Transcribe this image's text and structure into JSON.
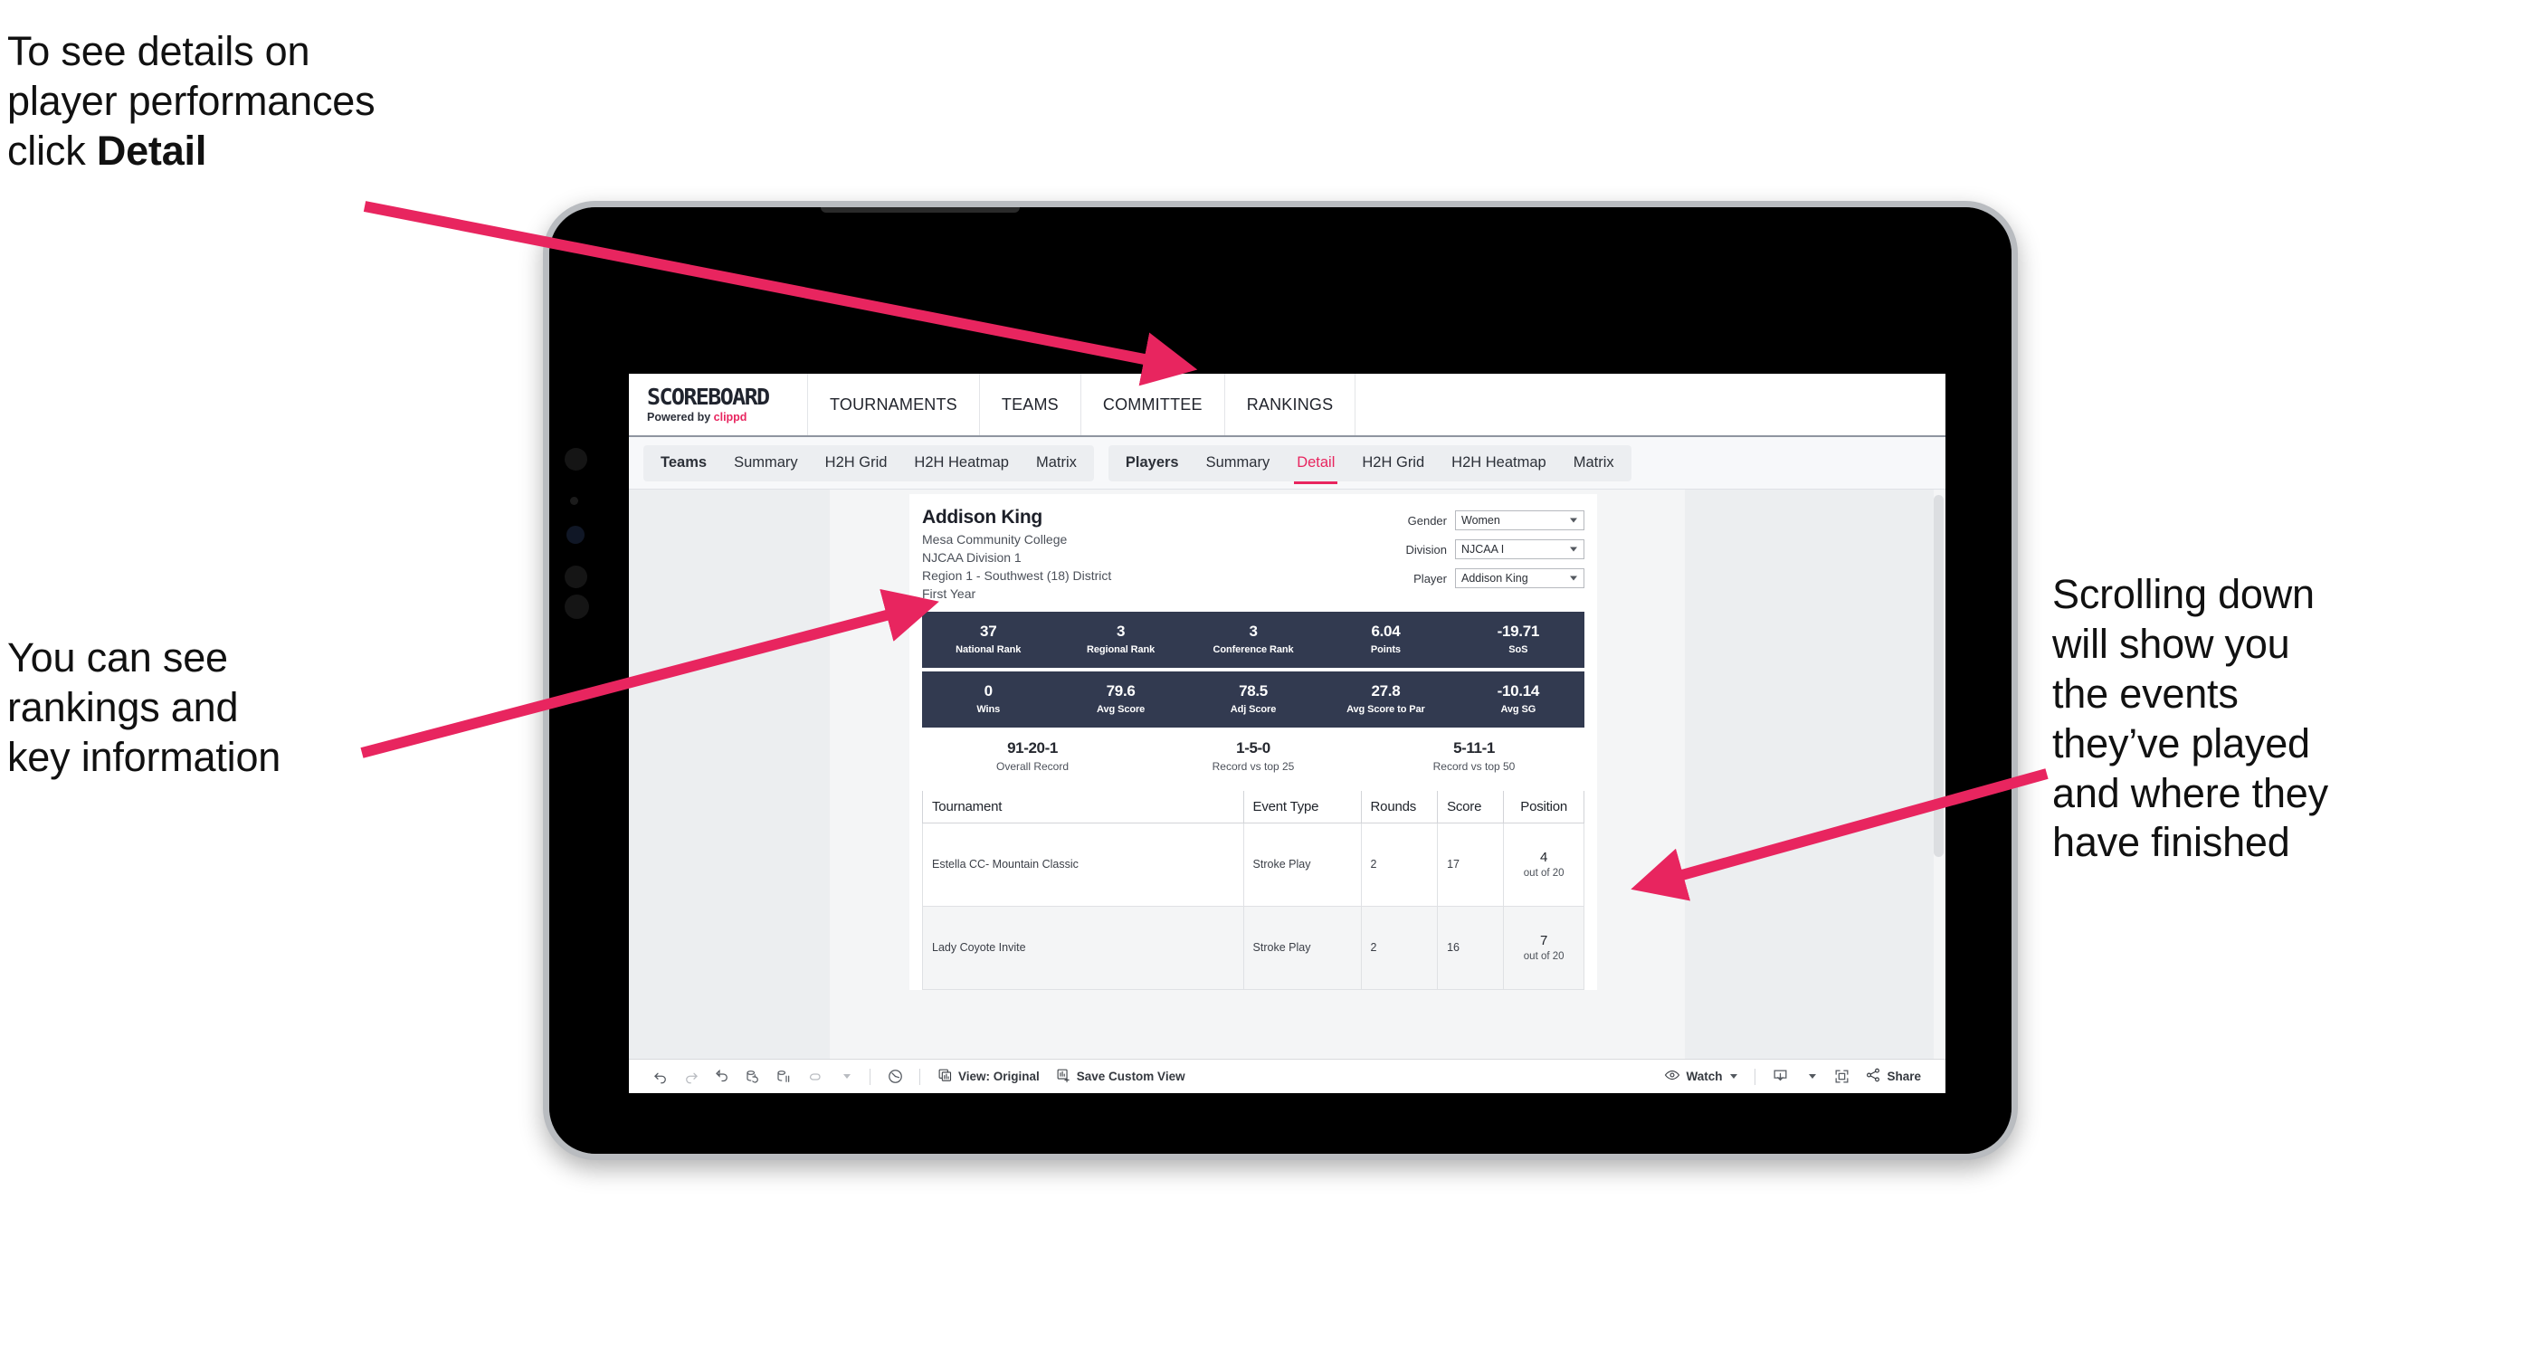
{
  "annotations": {
    "detail": "To see details on\nplayer performances\nclick ",
    "detail_bold": "Detail",
    "rankings": "You can see\nrankings and\nkey information",
    "scrolling": "Scrolling down\nwill show you\nthe events\nthey’ve played\nand where they\nhave finished"
  },
  "app": {
    "brand_title": "SCOREBOARD",
    "brand_sub_prefix": "Powered by ",
    "brand_sub_name": "clippd",
    "top_nav": [
      "TOURNAMENTS",
      "TEAMS",
      "COMMITTEE",
      "RANKINGS"
    ],
    "tab_groups": [
      {
        "lead": "Teams",
        "tabs": [
          "Summary",
          "H2H Grid",
          "H2H Heatmap",
          "Matrix"
        ],
        "active": null
      },
      {
        "lead": "Players",
        "tabs": [
          "Summary",
          "Detail",
          "H2H Grid",
          "H2H Heatmap",
          "Matrix"
        ],
        "active": "Detail"
      }
    ],
    "accent_color": "#e8255f",
    "kpi_band_color": "#323a50"
  },
  "player": {
    "name": "Addison King",
    "school": "Mesa Community College",
    "division": "NJCAA Division 1",
    "region": "Region 1 - Southwest (18) District",
    "year": "First Year"
  },
  "filters": [
    {
      "label": "Gender",
      "value": "Women"
    },
    {
      "label": "Division",
      "value": "NJCAA I"
    },
    {
      "label": "Player",
      "value": "Addison King"
    }
  ],
  "kpis_row1": [
    {
      "value": "37",
      "label": "National Rank"
    },
    {
      "value": "3",
      "label": "Regional Rank"
    },
    {
      "value": "3",
      "label": "Conference Rank"
    },
    {
      "value": "6.04",
      "label": "Points"
    },
    {
      "value": "-19.71",
      "label": "SoS"
    }
  ],
  "kpis_row2": [
    {
      "value": "0",
      "label": "Wins"
    },
    {
      "value": "79.6",
      "label": "Avg Score"
    },
    {
      "value": "78.5",
      "label": "Adj Score"
    },
    {
      "value": "27.8",
      "label": "Avg Score to Par"
    },
    {
      "value": "-10.14",
      "label": "Avg SG"
    }
  ],
  "records": [
    {
      "value": "91-20-1",
      "label": "Overall Record"
    },
    {
      "value": "1-5-0",
      "label": "Record vs top 25"
    },
    {
      "value": "5-11-1",
      "label": "Record vs top 50"
    }
  ],
  "table": {
    "headers": [
      "Tournament",
      "Event Type",
      "Rounds",
      "Score",
      "Position"
    ],
    "rows": [
      {
        "tournament": "Estella CC- Mountain Classic",
        "event_type": "Stroke Play",
        "rounds": "2",
        "score": "17",
        "position": "4",
        "position_sub": "out of 20"
      },
      {
        "tournament": "Lady Coyote Invite",
        "event_type": "Stroke Play",
        "rounds": "2",
        "score": "16",
        "position": "7",
        "position_sub": "out of 20"
      }
    ]
  },
  "toolbar": {
    "view_label": "View: Original",
    "save_label": "Save Custom View",
    "watch_label": "Watch",
    "share_label": "Share"
  }
}
